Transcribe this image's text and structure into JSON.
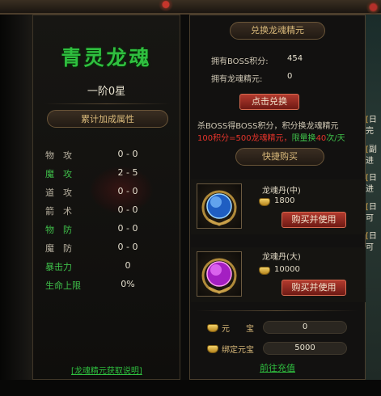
{
  "left_panel": {
    "title": "青灵龙魂",
    "rank": "一阶0星",
    "attr_header": "累计加成属性",
    "attributes": [
      {
        "name": "物　攻",
        "value": "0 - 0",
        "color": "grey"
      },
      {
        "name": "魔　攻",
        "value": "2 - 5",
        "color": "green"
      },
      {
        "name": "道　攻",
        "value": "0 - 0",
        "color": "grey"
      },
      {
        "name": "箭　术",
        "value": "0 - 0",
        "color": "grey"
      },
      {
        "name": "物　防",
        "value": "0 - 0",
        "color": "green"
      },
      {
        "name": "魔　防",
        "value": "0 - 0",
        "color": "grey"
      },
      {
        "name": "暴击力",
        "value": "0",
        "color": "green"
      },
      {
        "name": "生命上限",
        "value": "0%",
        "color": "green"
      }
    ],
    "help_link": "[龙魂精元获取说明]"
  },
  "exchange": {
    "header": "兑换龙魂精元",
    "boss_points_label": "拥有BOSS积分:",
    "boss_points_value": "454",
    "essence_label": "拥有龙魂精元:",
    "essence_value": "0",
    "redeem_button": "点击兑换",
    "info_line1": "杀BOSS得BOSS积分，积分换龙魂精元",
    "info_line2_a": "100积分=500龙魂精元，",
    "info_line2_b": "限量换",
    "info_line2_c": "40",
    "info_line2_d": "次/天"
  },
  "quick_buy": {
    "header": "快捷购买",
    "items": [
      {
        "name": "龙魂丹(中)",
        "price": "1800",
        "button": "购买并使用",
        "icon": "blue-orb-icon",
        "color": "#3a7fd8"
      },
      {
        "name": "龙魂丹(大)",
        "price": "10000",
        "button": "购买并使用",
        "icon": "purple-orb-icon",
        "color": "#c03ad8"
      }
    ]
  },
  "currency": {
    "yuanbao_label": "元　　宝",
    "yuanbao_value": "0",
    "bound_label": "绑定元宝",
    "bound_value": "5000",
    "recharge_link": "前往充值"
  },
  "side_sliver": [
    {
      "bracket": "[",
      "text": "日"
    },
    {
      "bracket": "",
      "text": "完"
    },
    {
      "bracket": "[",
      "text": "副"
    },
    {
      "bracket": "",
      "text": "进"
    },
    {
      "bracket": "[",
      "text": "日"
    },
    {
      "bracket": "",
      "text": "进"
    },
    {
      "bracket": "[",
      "text": "日"
    },
    {
      "bracket": "",
      "text": "可"
    },
    {
      "bracket": "[",
      "text": "日"
    },
    {
      "bracket": "",
      "text": "可"
    }
  ],
  "colors": {
    "accent_green": "#2fbf3f",
    "accent_red": "#e5342b",
    "gold": "#d9b97a"
  }
}
